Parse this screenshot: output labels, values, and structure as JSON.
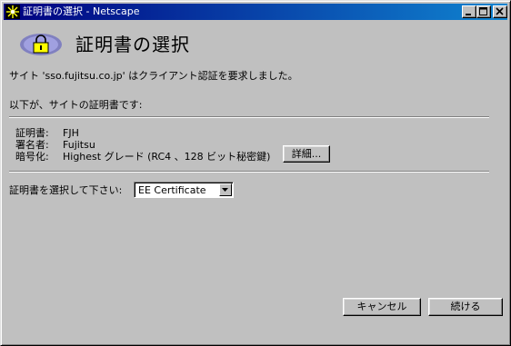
{
  "window": {
    "title": "証明書の選択 - Netscape",
    "app_icon": "netscape-star-icon",
    "controls": [
      "minimize-icon",
      "maximize-icon",
      "close-icon"
    ]
  },
  "dialog": {
    "icon": "lock-icon",
    "heading": "証明書の選択",
    "request_message": "サイト 'sso.fujitsu.co.jp' はクライアント認証を要求しました。",
    "intro": "以下が、サイトの証明書です:",
    "certificate": {
      "certificate_label": "証明書:",
      "certificate_value": "FJH",
      "signer_label": "署名者:",
      "signer_value": "Fujitsu",
      "encryption_label": "暗号化:",
      "encryption_value": "Highest グレード (RC4 、128 ビット秘密鍵)",
      "details_button": "詳細..."
    },
    "select_prompt": "証明書を選択して下さい:",
    "selected_certificate": "EE Certificate",
    "cancel_button": "キャンセル",
    "continue_button": "続ける"
  }
}
